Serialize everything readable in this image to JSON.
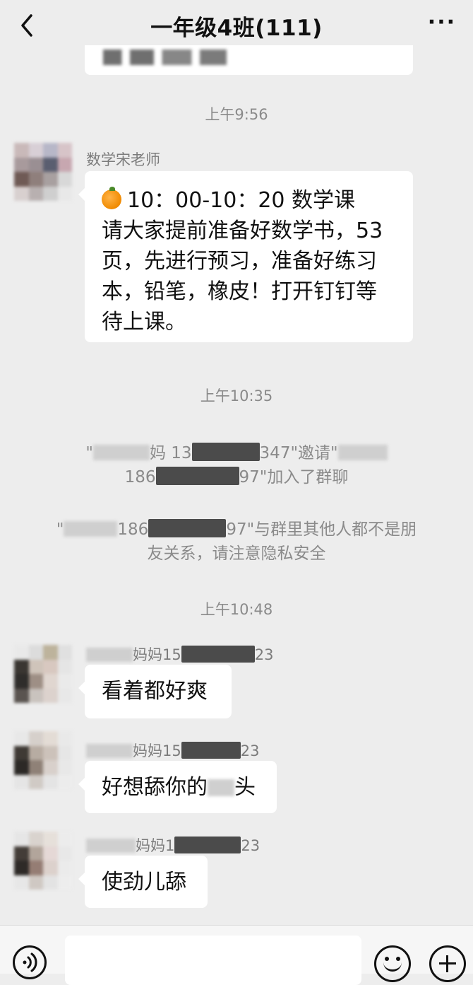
{
  "header": {
    "back_icon": "chevron-left-icon",
    "title": "一年级4班(111)",
    "more_label": "···"
  },
  "messages": {
    "time_1": "上午9:56",
    "teacher_name": "数学宋老师",
    "teacher_line_1": "10：00-10：20 数学课",
    "teacher_line_2": "请大家提前准备好数学书，53",
    "teacher_line_3": "页，先进行预习，准备好练习",
    "teacher_line_4": "本，铅笔，橡皮！打开钉钉等",
    "teacher_line_5": "待上课。",
    "time_2": "上午10:35",
    "sys1_a": "\"",
    "sys1_b": "妈 13",
    "sys1_c": "347\"邀请\"",
    "sys1_d": "186",
    "sys1_e": "97\"加入了群聊",
    "sys2_a": "\"",
    "sys2_b": "186",
    "sys2_c": "97\"与群里其他人都不是朋",
    "sys2_d": "友关系，请注意隐私安全",
    "time_3": "上午10:48",
    "m1_sender_a": "妈妈15",
    "m1_sender_b": "23",
    "m1_text": "看着都好爽",
    "m2_sender_a": "妈妈15",
    "m2_sender_b": "23",
    "m2_text_a": "好想舔你的",
    "m2_text_b": "头",
    "m3_sender_a": "妈妈1",
    "m3_sender_b": "23",
    "m3_text": "使劲儿舔"
  },
  "icons": {
    "voice": "voice-icon",
    "emoji": "emoji-icon",
    "plus": "plus-icon",
    "orange": "orange-emoji-icon"
  }
}
